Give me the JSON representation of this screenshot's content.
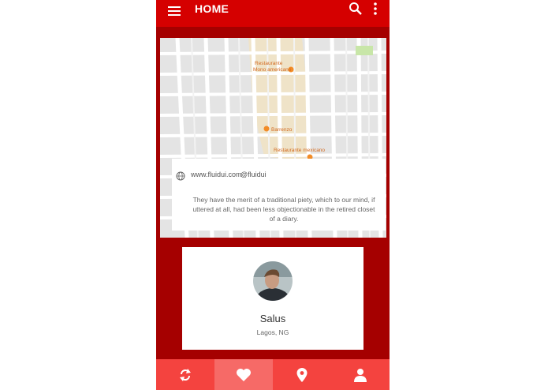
{
  "header": {
    "title": "HOME",
    "icons": [
      "menu-icon",
      "search-icon",
      "more-vert-icon"
    ]
  },
  "map": {
    "labels": {
      "place1": "Restaurante",
      "place1b": "Mono americano",
      "place2": "Barrenzo",
      "place3": "Restaurante mexicano"
    },
    "info": {
      "website": "www.fluidui.com",
      "handle": "@fluidui",
      "quote": "They have the merit of a traditional piety, which to our mind, if uttered at all, had been less objectionable in the retired closet of a diary."
    }
  },
  "profile": {
    "name": "Salus",
    "location": "Lagos, NG"
  },
  "bottom_nav": {
    "items": [
      "refresh-icon",
      "heart-icon",
      "location-pin-icon",
      "person-icon"
    ],
    "active_index": 1
  },
  "colors": {
    "appbar": "#d50000",
    "background": "#a50000",
    "bottom_nav": "#f4433f",
    "bottom_nav_active": "#f66a67"
  }
}
